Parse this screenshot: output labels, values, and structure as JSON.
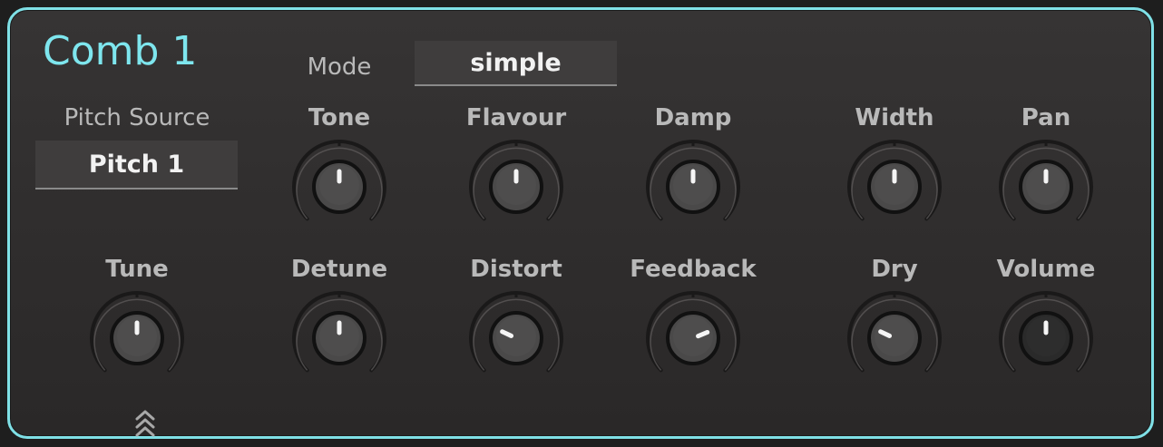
{
  "module": {
    "title": "Comb 1",
    "accent": "#7fe0e6"
  },
  "mode": {
    "label": "Mode",
    "value": "simple"
  },
  "pitch_source": {
    "label": "Pitch Source",
    "value": "Pitch 1"
  },
  "knobs": [
    {
      "id": "tone",
      "label": "Tone",
      "value": 0.5,
      "dark": false
    },
    {
      "id": "flavour",
      "label": "Flavour",
      "value": 0.5,
      "dark": false
    },
    {
      "id": "damp",
      "label": "Damp",
      "value": 0.5,
      "dark": false
    },
    {
      "id": "width",
      "label": "Width",
      "value": 0.5,
      "dark": false
    },
    {
      "id": "pan",
      "label": "Pan",
      "value": 0.5,
      "dark": false
    },
    {
      "id": "tune",
      "label": "Tune",
      "value": 0.5,
      "dark": false
    },
    {
      "id": "detune",
      "label": "Detune",
      "value": 0.5,
      "dark": false
    },
    {
      "id": "distort",
      "label": "Distort",
      "value": 0.26,
      "dark": false
    },
    {
      "id": "feedback",
      "label": "Feedback",
      "value": 0.75,
      "dark": false
    },
    {
      "id": "dry",
      "label": "Dry",
      "value": 0.26,
      "dark": false
    },
    {
      "id": "volume",
      "label": "Volume",
      "value": 0.5,
      "dark": true
    }
  ],
  "icons": {
    "expand": "chevron-up-triple-icon"
  }
}
